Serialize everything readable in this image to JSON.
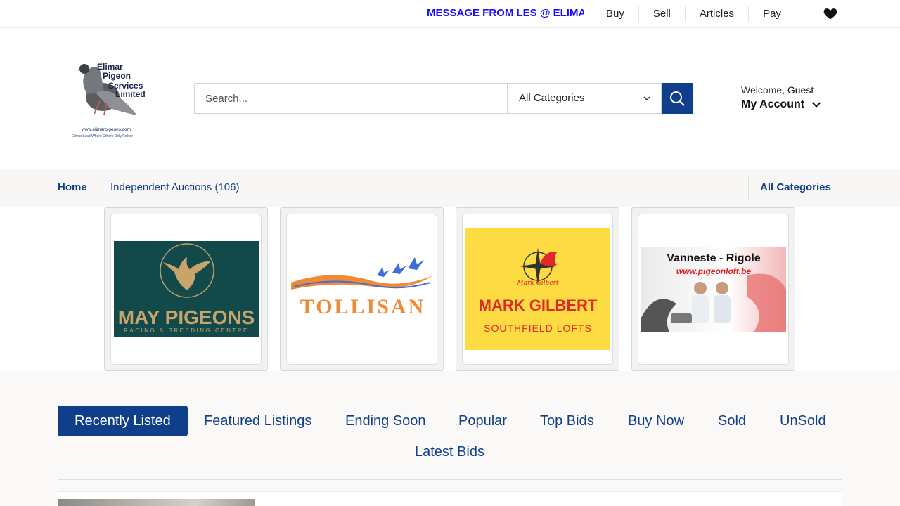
{
  "topbar": {
    "marquee": "MESSAGE FROM LES @ ELIMAR",
    "links": [
      "Buy",
      "Sell",
      "Articles",
      "Pay"
    ],
    "icons": {
      "wishlist": "heart-icon"
    }
  },
  "header": {
    "logo": {
      "lines": [
        "Elimar",
        "Pigeon",
        "Services",
        "Limited"
      ],
      "url": "www.elimarpigeons.com",
      "tagline": "Elimar Lead Where Others Only Follow"
    },
    "search": {
      "placeholder": "Search...",
      "category": "All Categories"
    },
    "account": {
      "welcome": "Welcome,",
      "user": "Guest",
      "label": "My Account"
    }
  },
  "nav": {
    "home": "Home",
    "independent_auctions": "Independent Auctions (106)",
    "all_categories": "All Categories"
  },
  "banners": [
    {
      "title": "MAY PIGEONS",
      "subtitle": "RACING & BREEDING CENTRE"
    },
    {
      "title": "TOLLISAN"
    },
    {
      "script": "Mark Gilbert",
      "title": "MARK GILBERT",
      "subtitle": "SOUTHFIELD LOFTS"
    },
    {
      "title": "Vanneste - Rigole",
      "subtitle": "www.pigeonloft.be"
    }
  ],
  "tabs": [
    "Recently Listed",
    "Featured Listings",
    "Ending Soon",
    "Popular",
    "Top Bids",
    "Buy Now",
    "Sold",
    "UnSold",
    "Latest Bids"
  ],
  "colors": {
    "brand": "#0f3f8a",
    "marquee": "#1a0dff",
    "may_bg": "#124a4b",
    "may_gold": "#c9a46a",
    "gilbert_bg": "#fddb43",
    "gilbert_red": "#e12828",
    "tollisan_orange": "#f08a35"
  }
}
